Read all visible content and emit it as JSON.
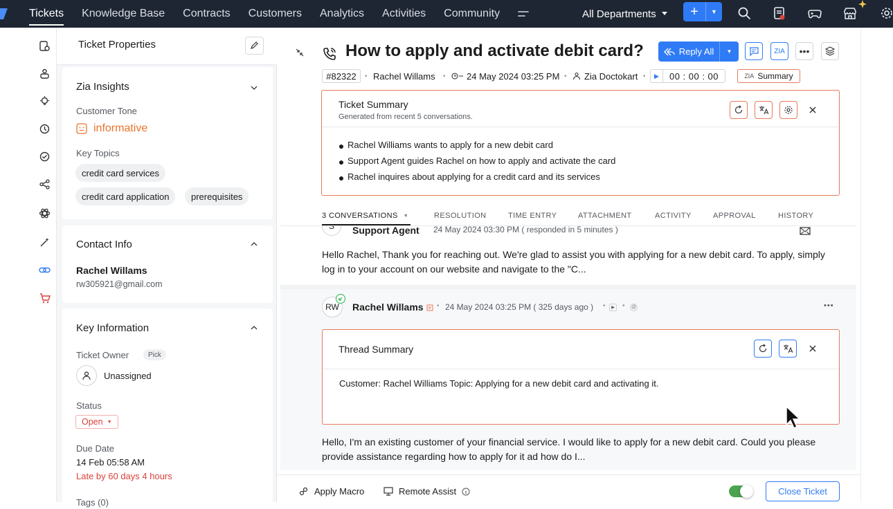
{
  "topnav": {
    "items": [
      "Tickets",
      "Knowledge Base",
      "Contracts",
      "Customers",
      "Analytics",
      "Activities",
      "Community"
    ],
    "active": "Tickets",
    "more_icon": "menu-icon",
    "department": "All Departments"
  },
  "side_panel": {
    "title": "Ticket Properties",
    "zia": {
      "title": "Zia Insights",
      "tone_label": "Customer Tone",
      "tone_value": "informative",
      "topics_label": "Key Topics",
      "topics": [
        "credit card services",
        "credit card application",
        "prerequisites"
      ]
    },
    "contact": {
      "title": "Contact Info",
      "name": "Rachel Willams",
      "email": "rw305921@gmail.com"
    },
    "key_info": {
      "title": "Key Information",
      "owner_label": "Ticket Owner",
      "pick_label": "Pick",
      "owner_value": "Unassigned",
      "status_label": "Status",
      "status_value": "Open",
      "due_label": "Due Date",
      "due_value": "14 Feb 05:58 AM",
      "late_text": "Late by 60 days 4 hours",
      "tags_label": "Tags (0)"
    }
  },
  "ticket": {
    "subject": "How to apply and activate debit card?",
    "reply_all": "Reply All",
    "id": "#82322",
    "contact": "Rachel Willams",
    "created": "24 May 2024 03:25 PM",
    "assignee": "Zia Doctokart",
    "timer": "00 : 00 : 00",
    "summary_btn": "Summary",
    "zia_badge": "ZIA"
  },
  "summary": {
    "title": "Ticket Summary",
    "subtitle": "Generated from recent 5 conversations.",
    "bullets": [
      "Rachel Williams wants to apply for a new debit card",
      "Support Agent guides Rachel on how to apply and activate the card",
      "Rachel inquires about applying for a credit card and its services"
    ]
  },
  "tabs": [
    "3 CONVERSATIONS",
    "RESOLUTION",
    "TIME ENTRY",
    "ATTACHMENT",
    "ACTIVITY",
    "APPROVAL",
    "HISTORY"
  ],
  "conversations": [
    {
      "author": "Support Agent",
      "avatar": "S",
      "time": "24 May 2024 03:30 PM ( responded in 5 minutes )",
      "body": "Hello Rachel, Thank you for reaching out. We're glad to assist you with applying for a new debit card. To apply, simply log in to your account on our website and navigate to the \"C..."
    },
    {
      "author": "Rachel Willams",
      "avatar": "RW",
      "time": "24 May 2024 03:25 PM ( 325 days ago )",
      "thread_summary_title": "Thread Summary",
      "thread_summary": "Customer: Rachel Williams Topic: Applying for a new debit card and activating it.",
      "body": "Hello, I'm an existing customer of your financial service. I would like to apply for a new debit card. Could you please provide assistance regarding how to apply for it ad how do I..."
    }
  ],
  "footer": {
    "apply_macro": "Apply Macro",
    "remote_assist": "Remote Assist",
    "close_ticket": "Close Ticket"
  },
  "colors": {
    "topbar": "#1e2633",
    "accent": "#2f7bf5",
    "tone": "#e8742c",
    "late": "#d9413a"
  }
}
